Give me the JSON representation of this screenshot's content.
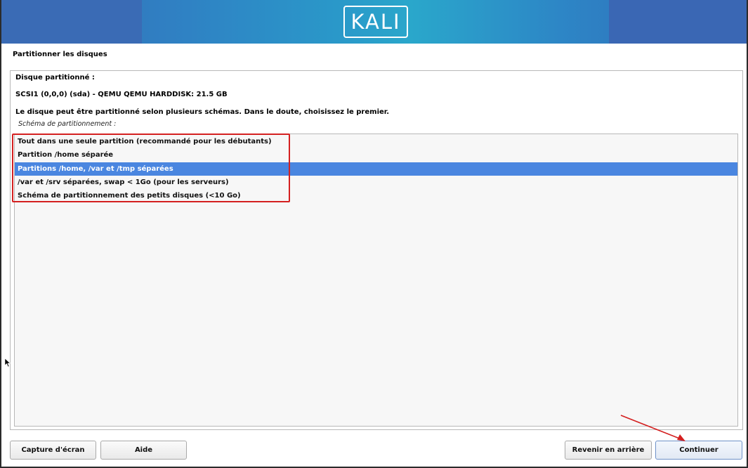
{
  "banner": {
    "logo_text": "KALI"
  },
  "page": {
    "title": "Partitionner les disques"
  },
  "content": {
    "disk_heading": "Disque partitionné :",
    "disk_name": "SCSI1 (0,0,0) (sda) - QEMU QEMU HARDDISK: 21.5 GB",
    "note": "Le disque peut être partitionné selon plusieurs schémas. Dans le doute, choisissez le premier.",
    "scheme_label": "Schéma de partitionnement :"
  },
  "schemes": [
    {
      "label": "Tout dans une seule partition (recommandé pour les débutants)",
      "selected": false
    },
    {
      "label": "Partition /home séparée",
      "selected": false
    },
    {
      "label": "Partitions /home, /var et /tmp séparées",
      "selected": true
    },
    {
      "label": "/var et /srv séparées, swap < 1Go (pour les serveurs)",
      "selected": false
    },
    {
      "label": "Schéma de partitionnement des petits disques (<10 Go)",
      "selected": false
    }
  ],
  "buttons": {
    "screenshot": "Capture d'écran",
    "help": "Aide",
    "back": "Revenir en arrière",
    "continue": "Continuer"
  },
  "colors": {
    "selection": "#4a86e0",
    "annotation": "#d42020"
  },
  "icons": {
    "cursor": "mouse-pointer-icon",
    "annotation_arrow": "red-arrow-annotation"
  }
}
